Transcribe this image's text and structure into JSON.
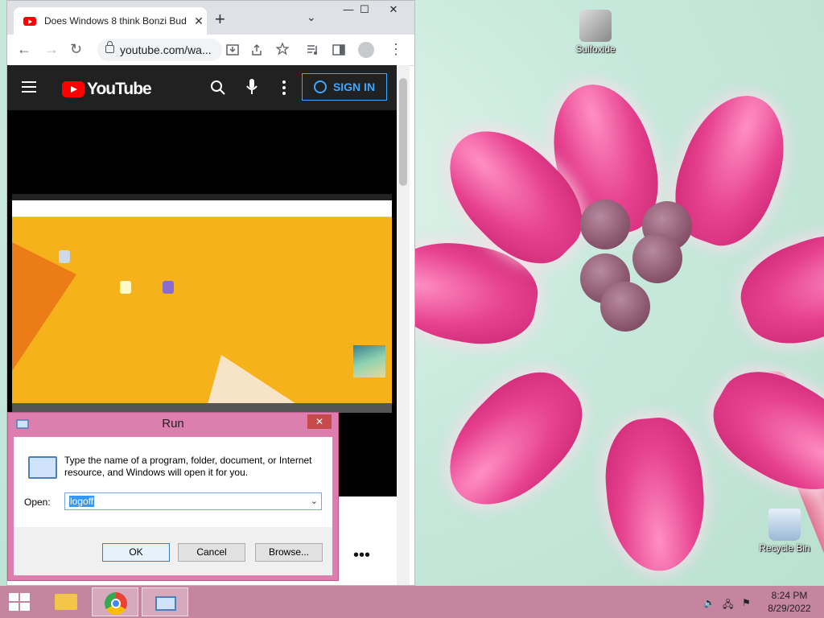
{
  "chrome": {
    "tab_title": "Does Windows 8 think Bonzi Bud",
    "tab_close": "✕",
    "new_tab": "+",
    "tab_menu": "⌄",
    "minimize": "—",
    "maximize": "☐",
    "close": "✕",
    "url": "youtube.com/wa...",
    "back": "←",
    "forward": "→",
    "reload": "↻"
  },
  "youtube": {
    "logo_text": "YouTube",
    "signin_label": "SIGN IN",
    "search_icon": "⌕",
    "mic_icon": "🎤",
    "more_icon": "⋮",
    "more_dots": "•••"
  },
  "run_dialog": {
    "title": "Run",
    "close": "✕",
    "description": "Type the name of a program, folder, document, or Internet resource, and Windows will open it for you.",
    "open_label": "Open:",
    "open_value": "logoff",
    "ok_label": "OK",
    "cancel_label": "Cancel",
    "browse_label": "Browse..."
  },
  "desktop": {
    "icons": [
      {
        "label": "Sulfoxide",
        "icon": "sulfoxide-icon"
      },
      {
        "label": "Recycle Bin",
        "icon": "recycle-bin-icon"
      }
    ]
  },
  "taskbar": {
    "time": "8:24 PM",
    "date": "8/29/2022",
    "apps": [
      "file-explorer",
      "google-chrome",
      "run"
    ]
  },
  "colors": {
    "taskbar": "#c6859f",
    "run_frame": "#dd7fae",
    "youtube_red": "#ff0000",
    "signin_blue": "#3ea6ff"
  }
}
